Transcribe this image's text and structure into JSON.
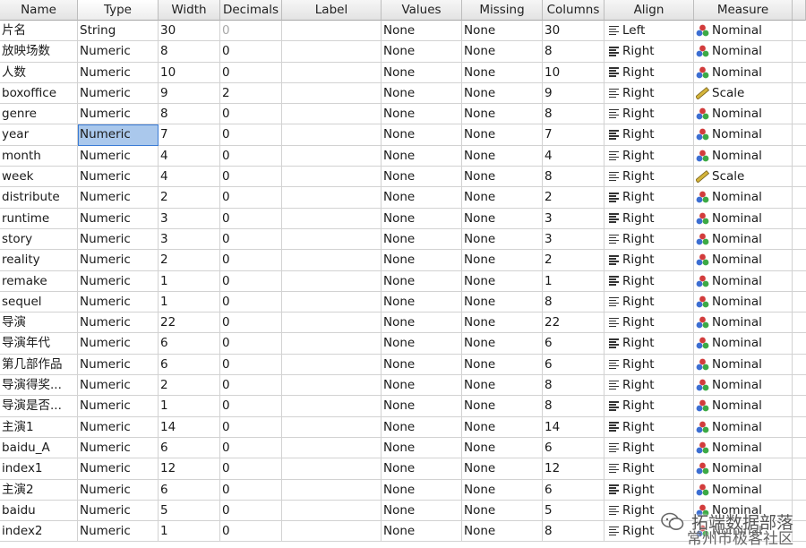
{
  "headers": [
    "Name",
    "Type",
    "Width",
    "Decimals",
    "Label",
    "Values",
    "Missing",
    "Columns",
    "Align",
    "Measure"
  ],
  "rows": [
    {
      "name": "片名",
      "type": "String",
      "width": "30",
      "decimals": "0",
      "label": "",
      "values": "None",
      "missing": "None",
      "columns": "30",
      "align": "Left",
      "measure": "Nominal"
    },
    {
      "name": "放映场数",
      "type": "Numeric",
      "width": "8",
      "decimals": "0",
      "label": "",
      "values": "None",
      "missing": "None",
      "columns": "8",
      "align": "Right",
      "measure": "Nominal"
    },
    {
      "name": "人数",
      "type": "Numeric",
      "width": "10",
      "decimals": "0",
      "label": "",
      "values": "None",
      "missing": "None",
      "columns": "10",
      "align": "Right",
      "measure": "Nominal"
    },
    {
      "name": "boxoffice",
      "type": "Numeric",
      "width": "9",
      "decimals": "2",
      "label": "",
      "values": "None",
      "missing": "None",
      "columns": "9",
      "align": "Right",
      "measure": "Scale"
    },
    {
      "name": "genre",
      "type": "Numeric",
      "width": "8",
      "decimals": "0",
      "label": "",
      "values": "None",
      "missing": "None",
      "columns": "8",
      "align": "Right",
      "measure": "Nominal"
    },
    {
      "name": "year",
      "type": "Numeric",
      "width": "7",
      "decimals": "0",
      "label": "",
      "values": "None",
      "missing": "None",
      "columns": "7",
      "align": "Right",
      "measure": "Nominal"
    },
    {
      "name": "month",
      "type": "Numeric",
      "width": "4",
      "decimals": "0",
      "label": "",
      "values": "None",
      "missing": "None",
      "columns": "4",
      "align": "Right",
      "measure": "Nominal"
    },
    {
      "name": "week",
      "type": "Numeric",
      "width": "4",
      "decimals": "0",
      "label": "",
      "values": "None",
      "missing": "None",
      "columns": "8",
      "align": "Right",
      "measure": "Scale"
    },
    {
      "name": "distribute",
      "type": "Numeric",
      "width": "2",
      "decimals": "0",
      "label": "",
      "values": "None",
      "missing": "None",
      "columns": "2",
      "align": "Right",
      "measure": "Nominal"
    },
    {
      "name": "runtime",
      "type": "Numeric",
      "width": "3",
      "decimals": "0",
      "label": "",
      "values": "None",
      "missing": "None",
      "columns": "3",
      "align": "Right",
      "measure": "Nominal"
    },
    {
      "name": "story",
      "type": "Numeric",
      "width": "3",
      "decimals": "0",
      "label": "",
      "values": "None",
      "missing": "None",
      "columns": "3",
      "align": "Right",
      "measure": "Nominal"
    },
    {
      "name": "reality",
      "type": "Numeric",
      "width": "2",
      "decimals": "0",
      "label": "",
      "values": "None",
      "missing": "None",
      "columns": "2",
      "align": "Right",
      "measure": "Nominal"
    },
    {
      "name": "remake",
      "type": "Numeric",
      "width": "1",
      "decimals": "0",
      "label": "",
      "values": "None",
      "missing": "None",
      "columns": "1",
      "align": "Right",
      "measure": "Nominal"
    },
    {
      "name": "sequel",
      "type": "Numeric",
      "width": "1",
      "decimals": "0",
      "label": "",
      "values": "None",
      "missing": "None",
      "columns": "8",
      "align": "Right",
      "measure": "Nominal"
    },
    {
      "name": "导演",
      "type": "Numeric",
      "width": "22",
      "decimals": "0",
      "label": "",
      "values": "None",
      "missing": "None",
      "columns": "22",
      "align": "Right",
      "measure": "Nominal"
    },
    {
      "name": "导演年代",
      "type": "Numeric",
      "width": "6",
      "decimals": "0",
      "label": "",
      "values": "None",
      "missing": "None",
      "columns": "6",
      "align": "Right",
      "measure": "Nominal"
    },
    {
      "name": "第几部作品",
      "type": "Numeric",
      "width": "6",
      "decimals": "0",
      "label": "",
      "values": "None",
      "missing": "None",
      "columns": "6",
      "align": "Right",
      "measure": "Nominal"
    },
    {
      "name": "导演得奖...",
      "type": "Numeric",
      "width": "2",
      "decimals": "0",
      "label": "",
      "values": "None",
      "missing": "None",
      "columns": "8",
      "align": "Right",
      "measure": "Nominal"
    },
    {
      "name": "导演是否...",
      "type": "Numeric",
      "width": "1",
      "decimals": "0",
      "label": "",
      "values": "None",
      "missing": "None",
      "columns": "8",
      "align": "Right",
      "measure": "Nominal"
    },
    {
      "name": "主演1",
      "type": "Numeric",
      "width": "14",
      "decimals": "0",
      "label": "",
      "values": "None",
      "missing": "None",
      "columns": "14",
      "align": "Right",
      "measure": "Nominal"
    },
    {
      "name": "baidu_A",
      "type": "Numeric",
      "width": "6",
      "decimals": "0",
      "label": "",
      "values": "None",
      "missing": "None",
      "columns": "6",
      "align": "Right",
      "measure": "Nominal"
    },
    {
      "name": "index1",
      "type": "Numeric",
      "width": "12",
      "decimals": "0",
      "label": "",
      "values": "None",
      "missing": "None",
      "columns": "12",
      "align": "Right",
      "measure": "Nominal"
    },
    {
      "name": "主演2",
      "type": "Numeric",
      "width": "6",
      "decimals": "0",
      "label": "",
      "values": "None",
      "missing": "None",
      "columns": "6",
      "align": "Right",
      "measure": "Nominal"
    },
    {
      "name": "baidu",
      "type": "Numeric",
      "width": "5",
      "decimals": "0",
      "label": "",
      "values": "None",
      "missing": "None",
      "columns": "5",
      "align": "Right",
      "measure": "Nominal"
    },
    {
      "name": "index2",
      "type": "Numeric",
      "width": "1",
      "decimals": "0",
      "label": "",
      "values": "None",
      "missing": "None",
      "columns": "8",
      "align": "Right",
      "measure": "Nominal"
    }
  ],
  "watermark": {
    "line1": "拓端数据部落",
    "line2": "常州市极客社区"
  },
  "colors": {
    "selection": "#aac8ec",
    "nominal_red": "#d23c3c",
    "nominal_blue": "#3c6ed2",
    "nominal_green": "#3caa46",
    "scale_ruler": "#d4b43a"
  }
}
